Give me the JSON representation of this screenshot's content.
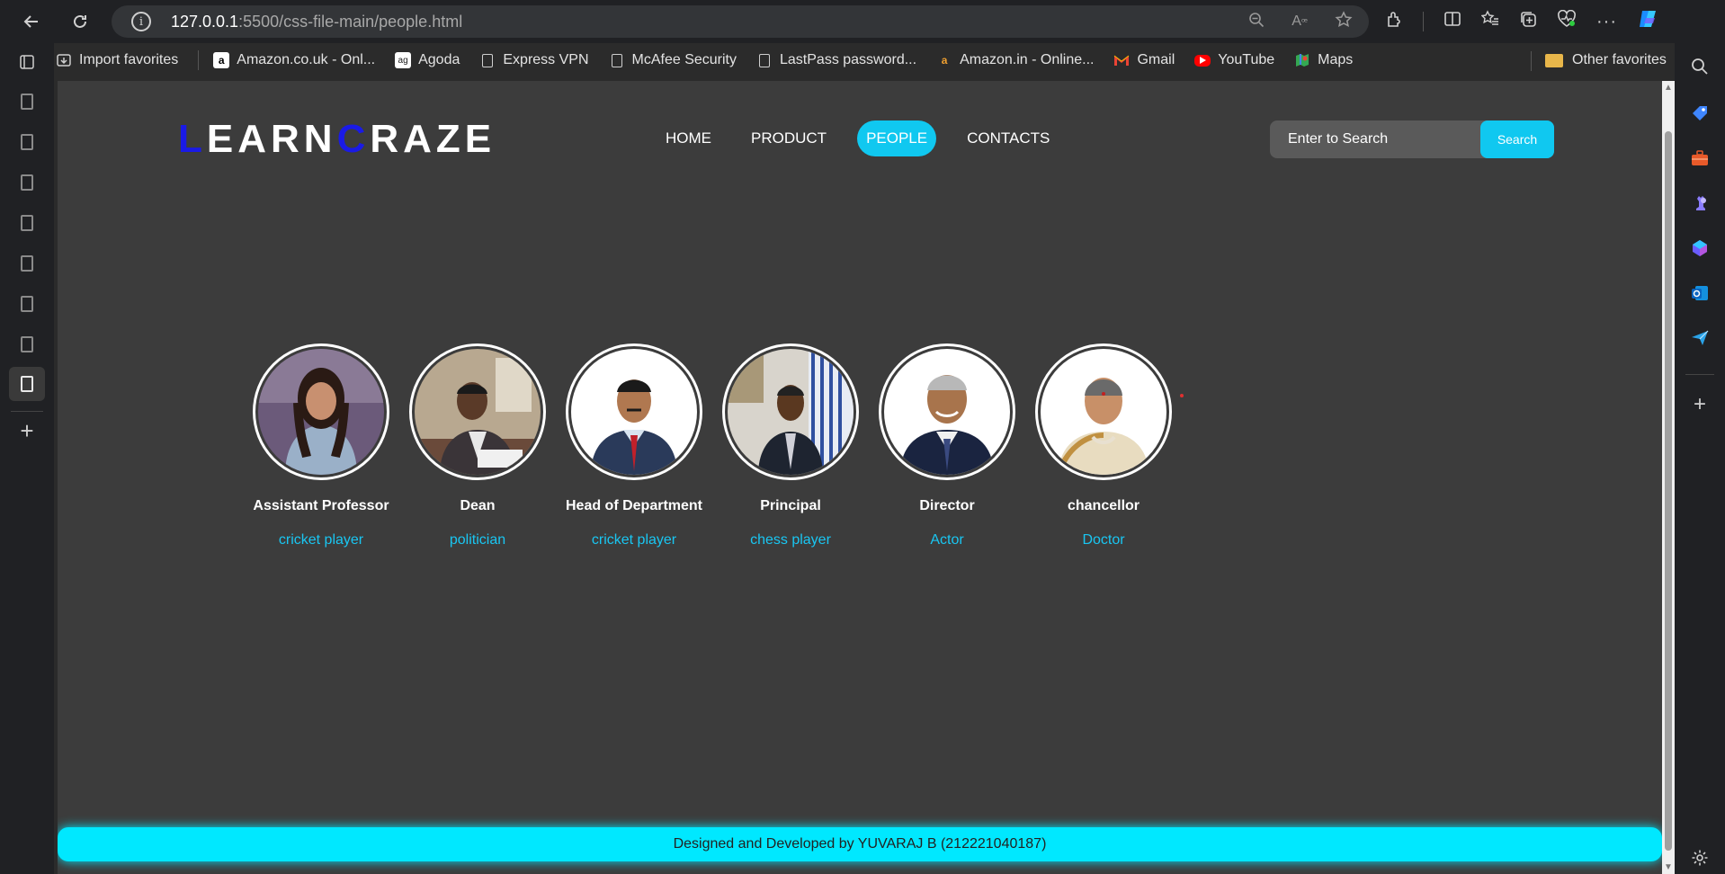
{
  "browser": {
    "url_host": "127.0.0.1",
    "url_path": ":5500/css-file-main/people.html",
    "favorites": [
      {
        "label": "Import favorites",
        "icon": "import-icon"
      },
      {
        "label": "Amazon.co.uk - Onl...",
        "icon": "amazon-icon"
      },
      {
        "label": "Agoda",
        "icon": "agoda-icon"
      },
      {
        "label": "Express VPN",
        "icon": "page-icon"
      },
      {
        "label": "McAfee Security",
        "icon": "page-icon"
      },
      {
        "label": "LastPass password...",
        "icon": "page-icon"
      },
      {
        "label": "Amazon.in - Online...",
        "icon": "amazon-icon"
      },
      {
        "label": "Gmail",
        "icon": "gmail-icon"
      },
      {
        "label": "YouTube",
        "icon": "youtube-icon"
      },
      {
        "label": "Maps",
        "icon": "maps-icon"
      }
    ],
    "other_favorites": "Other favorites"
  },
  "site": {
    "logo": {
      "l": "L",
      "earn": "EARN",
      "c": "C",
      "raze": "RAZE"
    },
    "nav": [
      "HOME",
      "PRODUCT",
      "PEOPLE",
      "CONTACTS"
    ],
    "active_nav": "PEOPLE",
    "search_placeholder": "Enter to Search",
    "search_button": "Search",
    "accent": "#10c8f0",
    "logo_accent": "#1a1ae6"
  },
  "people": [
    {
      "title": "Assistant Professor",
      "role": "cricket player"
    },
    {
      "title": "Dean",
      "role": "politician"
    },
    {
      "title": "Head of Department",
      "role": "cricket player"
    },
    {
      "title": "Principal",
      "role": "chess player"
    },
    {
      "title": "Director",
      "role": "Actor"
    },
    {
      "title": "chancellor",
      "role": "Doctor"
    }
  ],
  "footer": "Designed and Developed by YUVARAJ B (212221040187)"
}
